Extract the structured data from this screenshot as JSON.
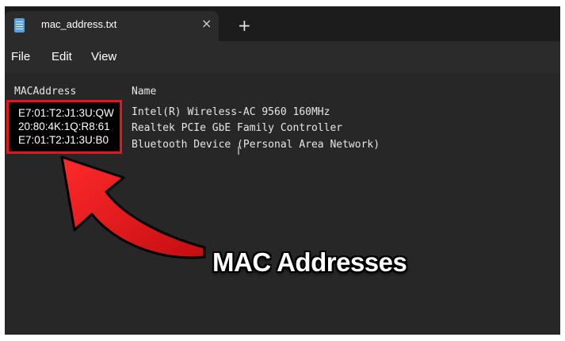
{
  "tab": {
    "title": "mac_address.txt",
    "close_glyph": "×",
    "new_tab_glyph": "+"
  },
  "menu": {
    "file": "File",
    "edit": "Edit",
    "view": "View"
  },
  "content": {
    "header_mac": "MACAddress",
    "header_name": "Name",
    "rows": [
      {
        "mac": "E7:01:T2:J1:3U:QW",
        "name": "Intel(R) Wireless-AC 9560 160MHz"
      },
      {
        "mac": "20:80:4K:1Q:R8:61",
        "name": "Realtek PCIe GbE Family Controller"
      },
      {
        "mac": "E7:01:T2:J1:3U:B0",
        "name": "Bluetooth Device (Personal Area Network)"
      }
    ]
  },
  "overlay": {
    "label": "MAC Addresses"
  },
  "colors": {
    "highlight": "#e8141a",
    "arrow": "#e8141a",
    "background": "#272727"
  },
  "icons": {
    "tab_icon": "notepad-icon",
    "cursor": "text-cursor-icon"
  }
}
